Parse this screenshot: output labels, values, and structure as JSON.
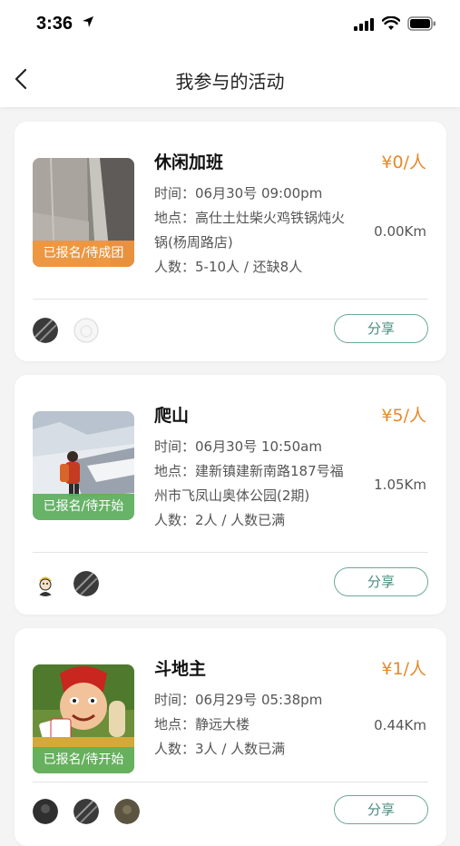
{
  "status_bar": {
    "time": "3:36"
  },
  "header": {
    "title": "我参与的活动"
  },
  "labels": {
    "time": "时间：",
    "place": "地点：",
    "people": "人数："
  },
  "activities": [
    {
      "title": "休闲加班",
      "price": "¥0/人",
      "status": "已报名/待成团",
      "status_color": "#f0963c",
      "time": "06月30号 09:00pm",
      "address_line1": "高仕土灶柴火鸡铁锅炖火",
      "address_line2": "锅(杨周路店)",
      "people": "5-10人 / 还缺8人",
      "distance": "0.00Km",
      "share_label": "分享",
      "thumbnail": "room-corner-photo",
      "avatars": [
        "dark-striped-avatar",
        "light-circle-avatar"
      ]
    },
    {
      "title": "爬山",
      "price": "¥5/人",
      "status": "已报名/待开始",
      "status_color": "#60b060",
      "time": "06月30号 10:50am",
      "address_line1": "建新镇建新南路187号福",
      "address_line2": "州市飞凤山奥体公园(2期)",
      "people": "2人 / 人数已满",
      "distance": "1.05Km",
      "share_label": "分享",
      "thumbnail": "mountain-hiker-photo",
      "avatars": [
        "cartoon-face-avatar",
        "dark-striped-avatar"
      ]
    },
    {
      "title": "斗地主",
      "price": "¥1/人",
      "status": "已报名/待开始",
      "status_color": "#60b060",
      "time": "06月29号 05:38pm",
      "address_line1": "静远大楼",
      "address_line2": "",
      "people": "3人 / 人数已满",
      "distance": "0.44Km",
      "share_label": "分享",
      "thumbnail": "card-game-character",
      "avatars": [
        "dark-avatar",
        "dark-striped-avatar",
        "olive-avatar"
      ]
    }
  ]
}
